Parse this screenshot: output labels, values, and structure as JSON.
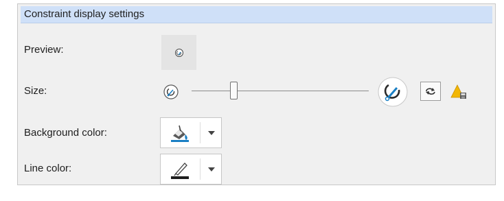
{
  "header": {
    "title": "Constraint display settings"
  },
  "preview": {
    "label": "Preview:",
    "icon": "constraint-preview-icon"
  },
  "size": {
    "label": "Size:",
    "min_icon": "constraint-small-icon",
    "max_icon": "constraint-large-icon",
    "slider_value": 0.24,
    "toggle_icon": "swap-arrows-icon",
    "warning_icon": "warning-save-icon"
  },
  "background_color": {
    "label": "Background color:",
    "icon": "paint-bucket-icon",
    "swatch": "#1a7fc4"
  },
  "line_color": {
    "label": "Line color:",
    "icon": "pen-line-icon",
    "swatch": "#1e1e1e"
  },
  "colors": {
    "header_bg": "#cfe0f8",
    "panel_bg": "#f0f0f0",
    "accent_blue": "#1a7fc4",
    "warning_yellow": "#f2b705"
  }
}
